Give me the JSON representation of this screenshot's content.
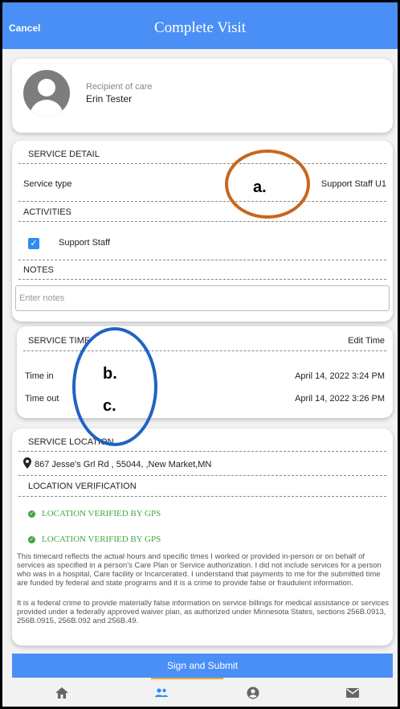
{
  "header": {
    "cancel_label": "Cancel",
    "title": "Complete Visit"
  },
  "recipient": {
    "label": "Recipient of care",
    "name": "Erin Tester"
  },
  "service_detail": {
    "heading": "SERVICE DETAIL",
    "service_type_label": "Service type",
    "service_type_value": "Support Staff U1",
    "activities_heading": "ACTIVITIES",
    "activity_label": "Support Staff",
    "activity_checked": true,
    "notes_heading": "NOTES",
    "notes_placeholder": "Enter notes"
  },
  "service_time": {
    "heading": "SERVICE TIME",
    "edit_label": "Edit Time",
    "time_in_label": "Time in",
    "time_in_value": "April 14, 2022 3:24 PM",
    "time_out_label": "Time out",
    "time_out_value": "April 14, 2022 3:26 PM"
  },
  "service_location": {
    "heading": "SERVICE LOCATION",
    "address": "867 Jesse's Grl Rd , 55044, ,New Market,MN",
    "verification_heading": "LOCATION VERIFICATION",
    "verified_1": "LOCATION VERIFIED BY GPS",
    "verified_2": "LOCATION VERIFIED BY GPS",
    "disclaimer_1": "This timecard reflects the actual hours and specific times I worked or provided in-person or on behalf of services as specified in a person's Care Plan or Service authorization. I did not include services for a person who was in a hospital, Care facility or Incarcerated. I understand that payments to me for the submitted time are funded by federal and state programs and it is a crime to provide false or fraudulent information.",
    "disclaimer_2": "It is a federal crime to provide materially false information on service billings for medical assistance or services provided under a federally approved waiver plan, as authorized under Minnesota States, sections 256B.0913, 256B.0915, 256B.092 and 256B.49."
  },
  "footer": {
    "submit_label": "Sign and Submit"
  },
  "annotations": {
    "a": "a.",
    "b": "b.",
    "c": "c."
  },
  "bottom_nav": {
    "items": [
      "home-icon",
      "people-icon",
      "account-icon",
      "mail-icon"
    ],
    "active": "people-icon"
  },
  "colors": {
    "primary": "#4a8ff5",
    "verified": "#44a544",
    "annotation_a": "#c8661c",
    "annotation_bc": "#1f63c6",
    "nav_indicator": "#e8a341"
  }
}
